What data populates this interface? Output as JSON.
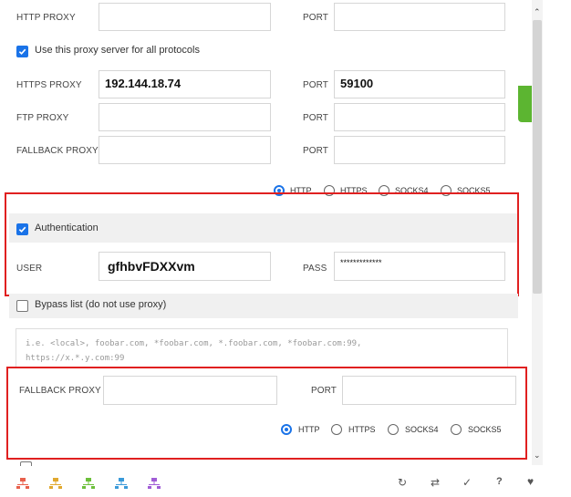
{
  "proxy": {
    "http_label": "HTTP PROXY",
    "http_value": "",
    "port_label": "PORT",
    "http_port": "",
    "use_for_all_label": "Use this proxy server for all protocols",
    "https_label": "HTTPS PROXY",
    "https_value": "192.144.18.74",
    "https_port": "59100",
    "ftp_label": "FTP PROXY",
    "ftp_value": "",
    "ftp_port": "",
    "fallback_label": "FALLBACK PROXY",
    "fallback_value": "",
    "fallback_port": ""
  },
  "protocols": [
    "HTTP",
    "HTTPS",
    "SOCKS4",
    "SOCKS5"
  ],
  "protocol_selected": "HTTP",
  "auth": {
    "label": "Authentication",
    "user_label": "USER",
    "user_value": "gfhbvFDXXvm",
    "pass_label": "PASS",
    "pass_value": "*************"
  },
  "bypass": {
    "label": "Bypass list (do not use proxy)",
    "placeholder_line1": "i.e. <local>, foobar.com, *foobar.com, *.foobar.com, *foobar.com:99,",
    "placeholder_line2": "https://x.*.y.com:99"
  },
  "overlay": {
    "fallback_label": "FALLBACK PROXY",
    "fallback_value": "",
    "port_label": "PORT",
    "fallback_port": "",
    "protocols": [
      "HTTP",
      "HTTPS",
      "SOCKS4",
      "SOCKS5"
    ],
    "protocol_selected": "HTTP"
  },
  "colors": {
    "accent": "#1a73e8",
    "highlight_border": "#e02020",
    "section_bg": "#f0f0f0",
    "green_edge": "#5cb531"
  }
}
